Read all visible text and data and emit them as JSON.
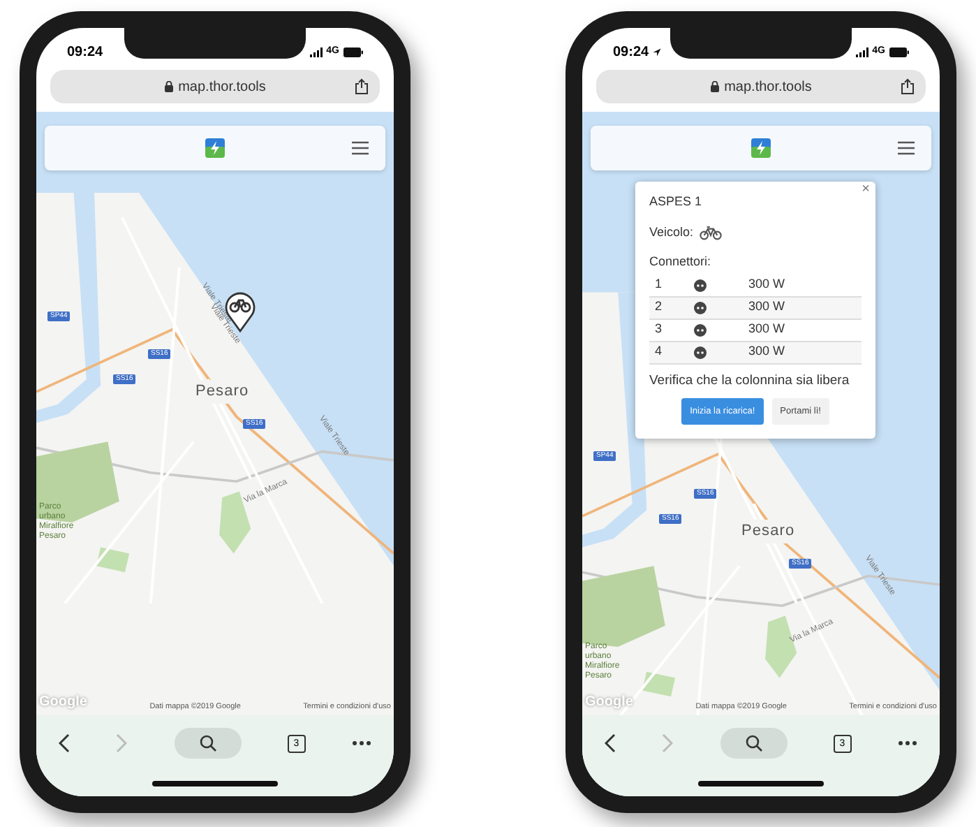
{
  "phones": [
    {
      "time": "09:24",
      "location_arrow": false,
      "network": "4G",
      "url": "map.thor.tools",
      "marker_shown": true,
      "map": {
        "place_label": "Pesaro",
        "road_labels": [
          "Viale Trieste",
          "Viale Trieste",
          "Via la Marca",
          "Viale Trieste"
        ],
        "route_badges": [
          "SP44",
          "SS16",
          "SS16",
          "SS16"
        ],
        "park_label": "Parco urbano Miralfiore Pesaro",
        "logo": "Google",
        "attribution": "Dati mappa ©2019 Google",
        "terms": "Termini e condizioni d'uso"
      },
      "tab_count": "3"
    },
    {
      "time": "09:24",
      "location_arrow": true,
      "network": "4G",
      "url": "map.thor.tools",
      "marker_shown": false,
      "map": {
        "place_label": "Pesaro",
        "road_labels": [
          "Via la Marca",
          "Viale Trieste"
        ],
        "route_badges": [
          "SP44",
          "SS16",
          "SS16",
          "SS16"
        ],
        "park_label": "Parco urbano Miralfiore Pesaro",
        "logo": "Google",
        "attribution": "Dati mappa ©2019 Google",
        "terms": "Termini e condizioni d'uso"
      },
      "tab_count": "3",
      "popup": {
        "close": "×",
        "title": "ASPES 1",
        "vehicle_label": "Veicolo:",
        "connectors_label": "Connettori:",
        "connectors": [
          {
            "number": "1",
            "power": "300 W"
          },
          {
            "number": "2",
            "power": "300 W"
          },
          {
            "number": "3",
            "power": "300 W"
          },
          {
            "number": "4",
            "power": "300 W"
          }
        ],
        "notice": "Verifica che la colonnina sia libera",
        "buttons": [
          {
            "label": "Inizia la ricarica!",
            "kind": "primary"
          },
          {
            "label": "Portami lì!",
            "kind": "secondary"
          }
        ]
      }
    }
  ]
}
